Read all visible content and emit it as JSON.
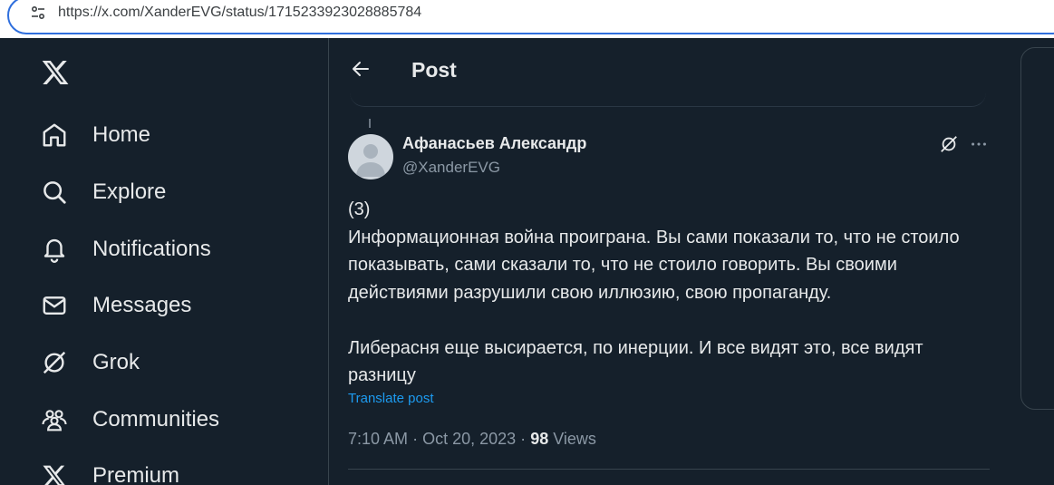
{
  "browser": {
    "url": "https://x.com/XanderEVG/status/1715233923028885784",
    "site_info_icon": "tune-icon"
  },
  "sidebar": {
    "logo_icon": "x-logo-icon",
    "items": [
      {
        "label": "Home",
        "icon": "home-icon"
      },
      {
        "label": "Explore",
        "icon": "search-icon"
      },
      {
        "label": "Notifications",
        "icon": "bell-icon"
      },
      {
        "label": "Messages",
        "icon": "mail-icon"
      },
      {
        "label": "Grok",
        "icon": "grok-icon"
      },
      {
        "label": "Communities",
        "icon": "communities-icon"
      },
      {
        "label": "Premium",
        "icon": "x-logo-icon"
      }
    ]
  },
  "header": {
    "title": "Post",
    "back_icon": "arrow-left-icon"
  },
  "post": {
    "author_name": "Афанасьев Александр",
    "author_handle": "@XanderEVG",
    "text": "(3)\nИнформационная война проиграна. Вы сами показали то, что не стоило показывать, сами сказали то, что не стоило говорить. Вы своими действиями разрушили свою иллюзию, свою пропаганду.\n\nЛиберасня еще высирается, по инерции. И все видят это, все видят разницу",
    "translate_label": "Translate post",
    "time": "7:10 AM",
    "separator": "·",
    "date": "Oct 20, 2023",
    "views_count": "98",
    "views_label": "Views"
  },
  "colors": {
    "background": "#15202b",
    "text": "#e7e9ea",
    "muted": "#8b98a5",
    "link": "#1d9bf0",
    "border": "#38444d"
  }
}
